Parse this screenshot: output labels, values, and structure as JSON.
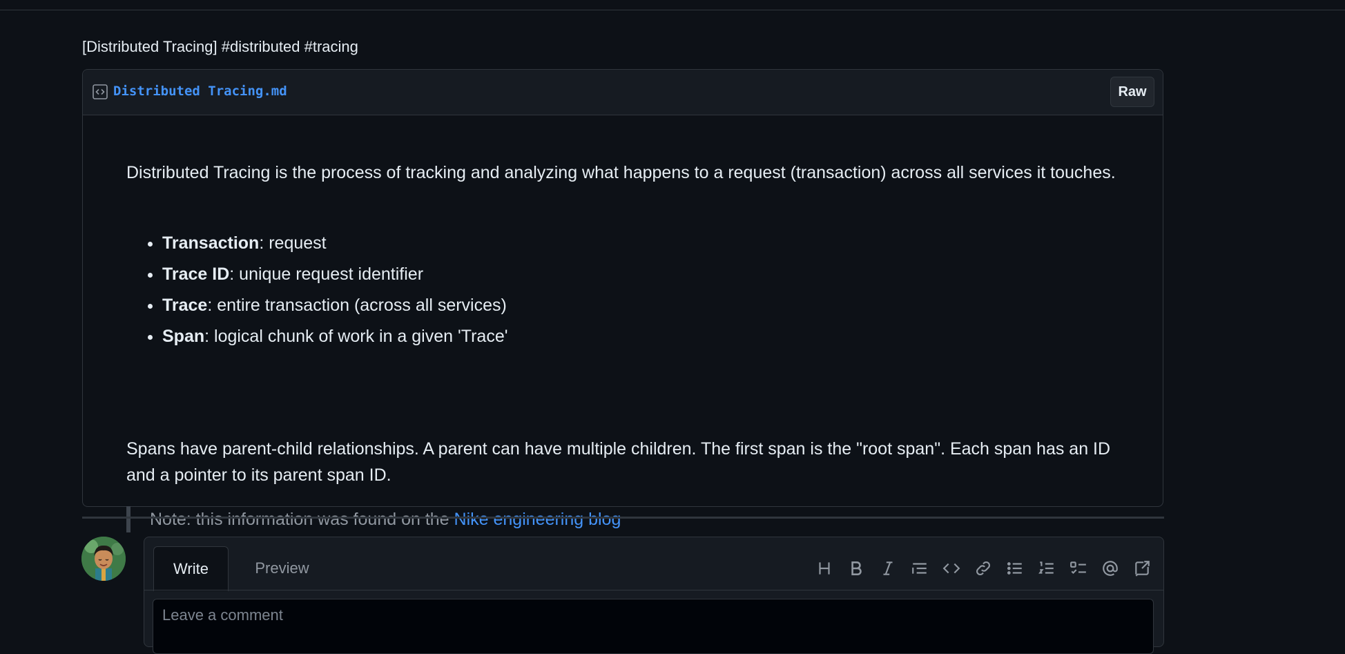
{
  "gist": {
    "description": "[Distributed Tracing] #distributed #tracing",
    "file": {
      "name": "Distributed Tracing.md",
      "raw_label": "Raw"
    }
  },
  "markdown": {
    "intro": "Distributed Tracing is the process of tracking and analyzing what happens to a request (transaction) across all services it touches.",
    "definitions": [
      {
        "term": "Transaction",
        "desc": ": request"
      },
      {
        "term": "Trace ID",
        "desc": ": unique request identifier"
      },
      {
        "term": "Trace",
        "desc": ": entire transaction (across all services)"
      },
      {
        "term": "Span",
        "desc": ": logical chunk of work in a given 'Trace'"
      }
    ],
    "paragraph": "Spans have parent-child relationships. A parent can have multiple children. The first span is the \"root span\". Each span has an ID and a pointer to its parent span ID.",
    "note_prefix": "Note: this information was found on the ",
    "note_link": "Nike engineering blog"
  },
  "comment": {
    "tabs": {
      "write": "Write",
      "preview": "Preview"
    },
    "placeholder": "Leave a comment",
    "toolbar_icons": [
      "heading-icon",
      "bold-icon",
      "italic-icon",
      "quote-icon",
      "code-icon",
      "link-icon",
      "unordered-list-icon",
      "ordered-list-icon",
      "task-list-icon",
      "mention-icon",
      "reference-icon"
    ]
  },
  "colors": {
    "background": "#0d1117",
    "link": "#4493f8",
    "border": "#30363d"
  }
}
